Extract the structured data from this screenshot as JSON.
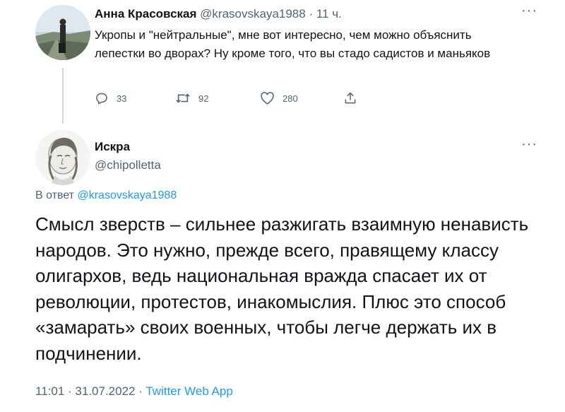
{
  "tweet1": {
    "author_name": "Анна Красовская",
    "author_handle": "@krasovskaya1988",
    "separator": "·",
    "time": "11 ч.",
    "text": "Укропы и \"нейтральные\", мне вот интересно, чем можно объяснить лепестки во дворах? Ну кроме того, что вы стадо садистов и маньяков",
    "replies_count": "33",
    "retweets_count": "92",
    "likes_count": "280",
    "more_label": "···"
  },
  "tweet2": {
    "author_name": "Искра",
    "author_handle": "@chipolletta",
    "more_label": "···",
    "reply_prefix": "В ответ",
    "reply_to_handle": "@krasovskaya1988",
    "text": "Смысл зверств – сильнее разжигать взаимную ненависть народов. Это нужно, прежде всего, правящему классу олигархов, ведь национальная вражда спасает их от революции, протестов, инакомыслия. Плюс это способ «замарать» своих военных, чтобы легче держать их в подчинении.",
    "time": "11:01",
    "date": "31.07.2022",
    "separator": "·",
    "source_app": "Twitter Web App"
  },
  "colors": {
    "text": "#0f1419",
    "secondary": "#536471",
    "link": "#1d9bf0",
    "thread_line": "#cfd9de"
  },
  "icons": [
    "reply-icon",
    "retweet-icon",
    "like-icon",
    "share-icon",
    "more-icon"
  ]
}
